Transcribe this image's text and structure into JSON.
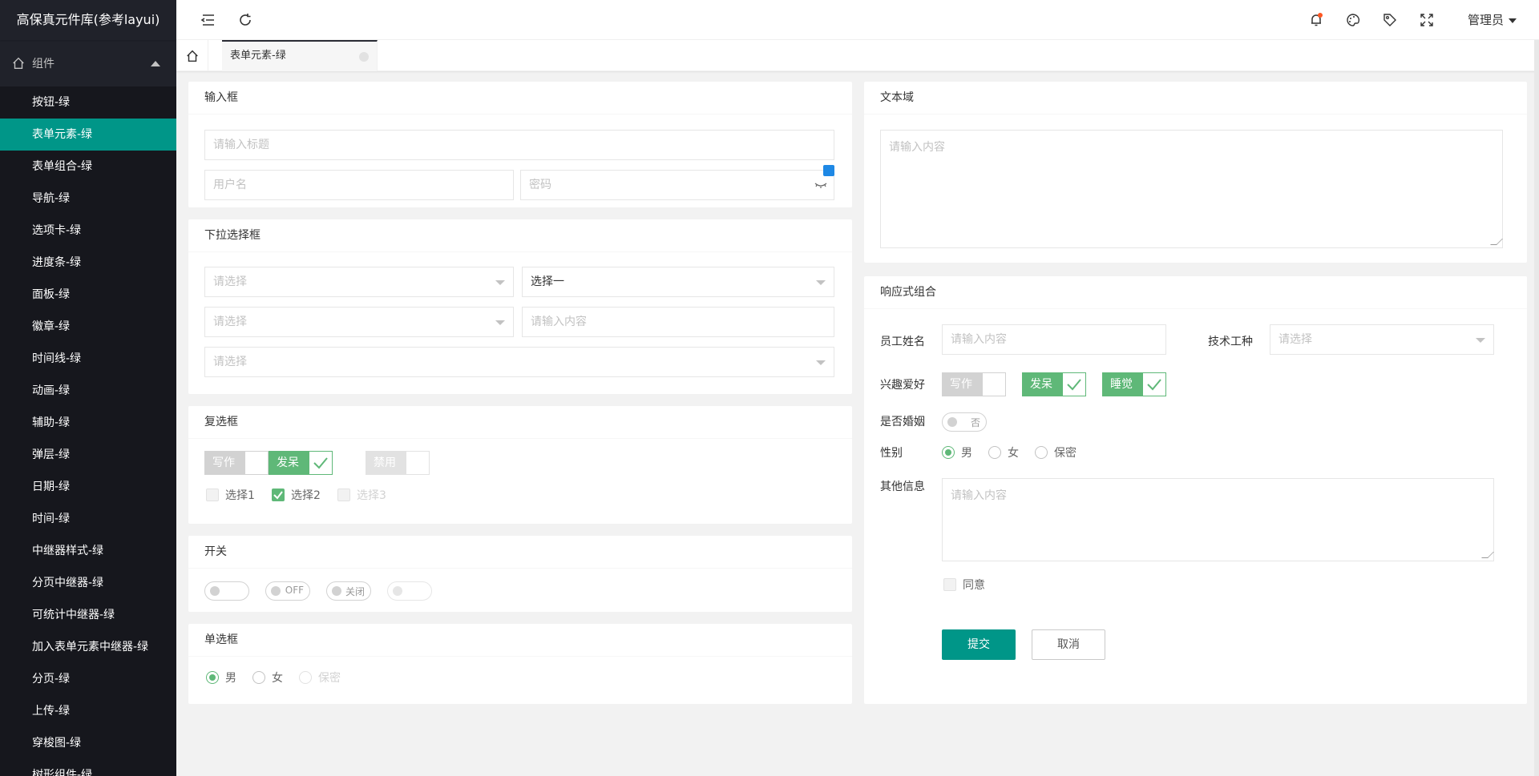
{
  "app": {
    "title": "高保真元件库(参考layui)"
  },
  "sidebar": {
    "group_label": "组件",
    "items": [
      {
        "label": "按钮-绿"
      },
      {
        "label": "表单元素-绿"
      },
      {
        "label": "表单组合-绿"
      },
      {
        "label": "导航-绿"
      },
      {
        "label": "选项卡-绿"
      },
      {
        "label": "进度条-绿"
      },
      {
        "label": "面板-绿"
      },
      {
        "label": "徽章-绿"
      },
      {
        "label": "时间线-绿"
      },
      {
        "label": "动画-绿"
      },
      {
        "label": "辅助-绿"
      },
      {
        "label": "弹层-绿"
      },
      {
        "label": "日期-绿"
      },
      {
        "label": "时间-绿"
      },
      {
        "label": "中继器样式-绿"
      },
      {
        "label": "分页中继器-绿"
      },
      {
        "label": "可统计中继器-绿"
      },
      {
        "label": "加入表单元素中继器-绿"
      },
      {
        "label": "分页-绿"
      },
      {
        "label": "上传-绿"
      },
      {
        "label": "穿梭图-绿"
      },
      {
        "label": "树形组件-绿"
      }
    ]
  },
  "header": {
    "admin_label": "管理员"
  },
  "tabs": {
    "active_label": "表单元素-绿"
  },
  "input_card": {
    "title": "输入框",
    "title_placeholder": "请输入标题",
    "username_placeholder": "用户名",
    "password_placeholder": "密码"
  },
  "select_card": {
    "title": "下拉选择框",
    "select1_placeholder": "请选择",
    "select2_value": "选择一",
    "select3_placeholder": "请选择",
    "input_placeholder": "请输入内容",
    "select4_placeholder": "请选择"
  },
  "checkbox_card": {
    "title": "复选框",
    "primary": [
      {
        "label": "写作"
      },
      {
        "label": "发呆"
      },
      {
        "label": "禁用"
      }
    ],
    "plain": [
      {
        "label": "选择1"
      },
      {
        "label": "选择2"
      },
      {
        "label": "选择3"
      }
    ]
  },
  "switch_card": {
    "title": "开关",
    "switches": [
      {
        "text": ""
      },
      {
        "text": "OFF"
      },
      {
        "text": "关闭"
      },
      {
        "text": ""
      }
    ]
  },
  "radio_card": {
    "title": "单选框",
    "options": [
      {
        "label": "男"
      },
      {
        "label": "女"
      },
      {
        "label": "保密"
      }
    ]
  },
  "textarea_card": {
    "title": "文本域",
    "placeholder": "请输入内容"
  },
  "responsive_card": {
    "title": "响应式组合",
    "name_label": "员工姓名",
    "name_placeholder": "请输入内容",
    "skill_label": "技术工种",
    "skill_placeholder": "请选择",
    "hobby_label": "兴趣爱好",
    "hobbies": [
      {
        "label": "写作"
      },
      {
        "label": "发呆"
      },
      {
        "label": "睡觉"
      }
    ],
    "married_label": "是否婚姻",
    "married_switch": "否",
    "gender_label": "性别",
    "genders": [
      {
        "label": "男"
      },
      {
        "label": "女"
      },
      {
        "label": "保密"
      }
    ],
    "other_label": "其他信息",
    "other_placeholder": "请输入内容",
    "agree_label": "同意",
    "submit_label": "提交",
    "cancel_label": "取消"
  },
  "colors": {
    "sidebar_bg": "#20222a",
    "accent": "#009688",
    "check_green": "#5fb878"
  }
}
